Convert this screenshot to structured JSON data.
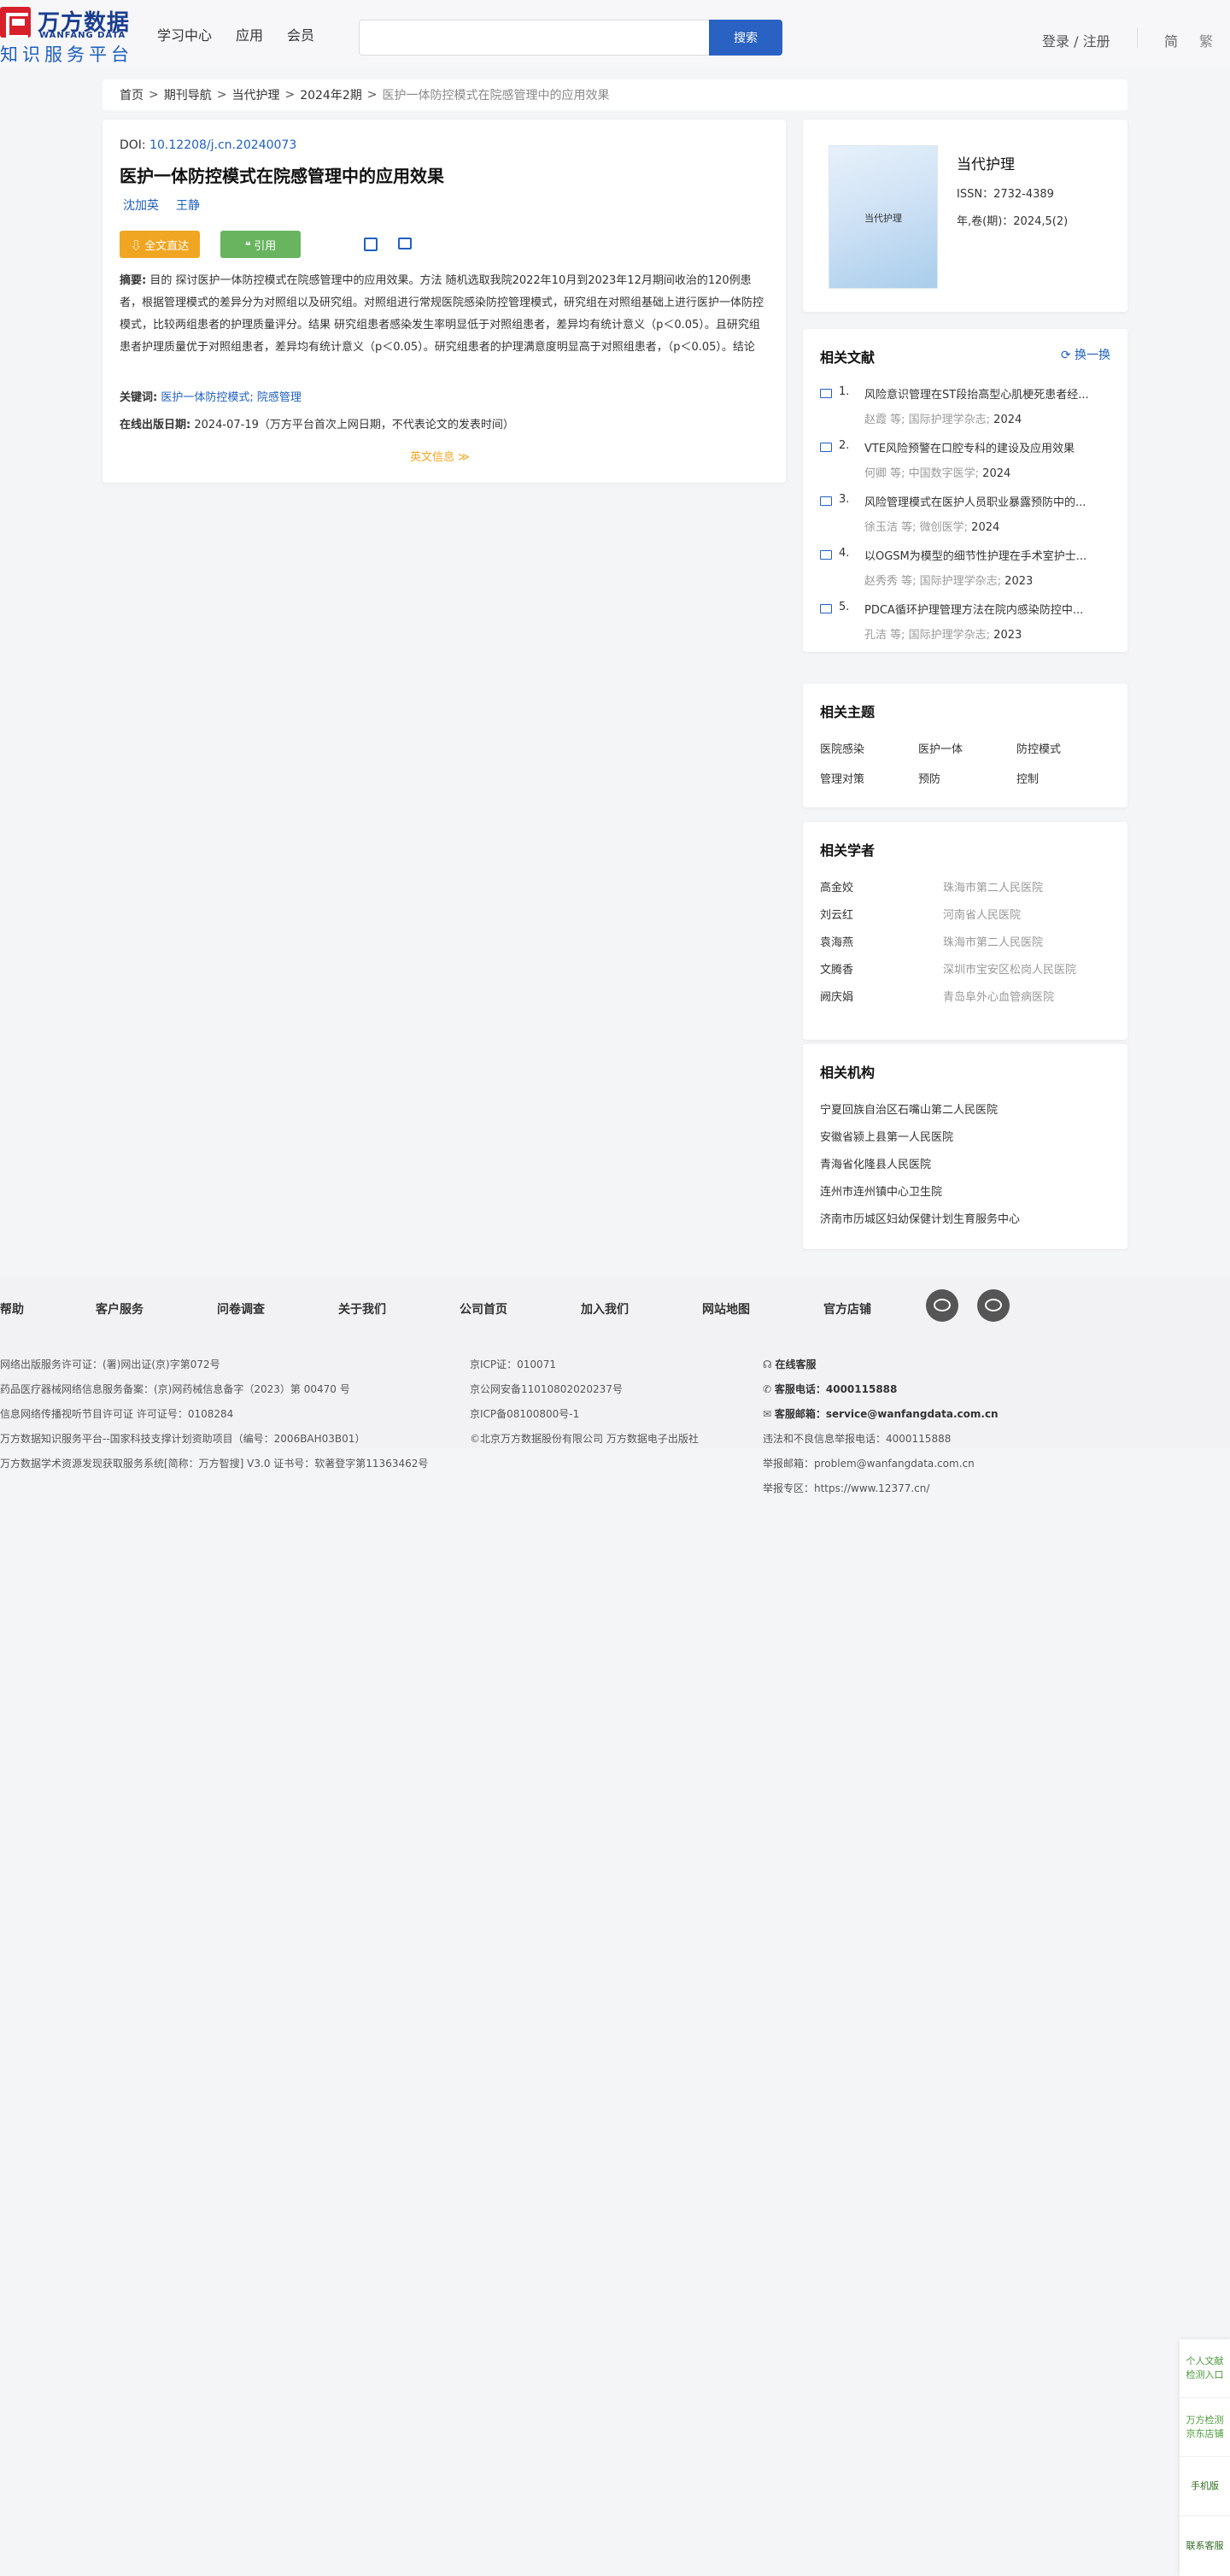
{
  "header": {
    "logo_cn": "万方数据",
    "logo_en": "WANFANG DATA",
    "logo_sub": "知识服务平台",
    "nav": [
      "学习中心",
      "应用",
      "会员"
    ],
    "search_button": "搜索",
    "search_placeholder": "",
    "login": "登录 / 注册",
    "lang_simp": "简",
    "lang_trad": "繁"
  },
  "breadcrumb": {
    "items": [
      "首页",
      "期刊导航",
      "当代护理",
      "2024年2期"
    ],
    "current": "医护一体防控模式在院感管理中的应用效果"
  },
  "article": {
    "doi_label": "DOI: ",
    "doi_value": "10.12208/j.cn.20240073",
    "title": "医护一体防控模式在院感管理中的应用效果",
    "authors": [
      "沈加英",
      "王静"
    ],
    "btn_full": "⇩ 全文直达",
    "btn_cite": "❝ 引用",
    "abstract_label": "摘要:",
    "abstract_text": " 目的 探讨医护一体防控模式在院感管理中的应用效果。方法 随机选取我院2022年10月到2023年12月期间收治的120例患者，根据管理模式的差异分为对照组以及研究组。对照组进行常规医院感染防控管理模式，研究组在对照组基础上进行医护一体防控模式，比较两组患者的护理质量评分。结果 研究组患者感染发生率明显低于对照组患者，差异均有统计意义（p＜0.05）。且研究组患者护理质量优于对照组患者，差异均有统计意义（p＜0.05）。研究组患者的护理满意度明显高于对照组患者，（p＜0.05）。结论 对患者采用医护一体防控模式效果显著，不但能保障患者的生命安全，降低感染...",
    "keywords_label": "关键词:",
    "keywords": "医护一体防控模式; 院感管理",
    "pubdate_label": "在线出版日期:",
    "pubdate": "2024-07-19（万方平台首次上网日期，不代表论文的发表时间）",
    "en_info": "英文信息 ≫"
  },
  "journal": {
    "cover_title": "当代护理",
    "name": "当代护理",
    "issn": "ISSN：2732-4389",
    "vol": "年,卷(期)：2024,5(2)"
  },
  "related": {
    "title": "相关文献",
    "refresh": "换一换",
    "items": [
      {
        "num": "1.",
        "title": "风险意识管理在ST段抬高型心肌梗死患者经...",
        "meta": "赵霞 等;  国际护理学杂志",
        "year": "2024"
      },
      {
        "num": "2.",
        "title": "VTE风险预警在口腔专科的建设及应用效果",
        "meta": "何卿 等;  中国数字医学",
        "year": "2024"
      },
      {
        "num": "3.",
        "title": "风险管理模式在医护人员职业暴露预防中的...",
        "meta": "徐玉洁 等;  微创医学",
        "year": "2024"
      },
      {
        "num": "4.",
        "title": "以OGSM为模型的细节性护理在手术室护士...",
        "meta": "赵秀秀 等;  国际护理学杂志",
        "year": "2023"
      },
      {
        "num": "5.",
        "title": "PDCA循环护理管理方法在院内感染防控中...",
        "meta": "孔洁 等;  国际护理学杂志",
        "year": "2023"
      }
    ]
  },
  "topics": {
    "title": "相关主题",
    "items": [
      "医院感染",
      "医护一体",
      "防控模式",
      "管理对策",
      "预防",
      "控制"
    ]
  },
  "scholars": {
    "title": "相关学者",
    "items": [
      {
        "name": "高金姣",
        "org": "珠海市第二人民医院"
      },
      {
        "name": "刘云红",
        "org": "河南省人民医院"
      },
      {
        "name": "袁海燕",
        "org": "珠海市第二人民医院"
      },
      {
        "name": "文腾香",
        "org": "深圳市宝安区松岗人民医院"
      },
      {
        "name": "阙庆娟",
        "org": "青岛阜外心血管病医院"
      }
    ]
  },
  "orgs": {
    "title": "相关机构",
    "items": [
      "宁夏回族自治区石嘴山第二人民医院",
      "安徽省颍上县第一人民医院",
      "青海省化隆县人民医院",
      "连州市连州镇中心卫生院",
      "济南市历城区妇幼保健计划生育服务中心"
    ]
  },
  "footer": {
    "links": [
      "帮助",
      "客户服务",
      "问卷调查",
      "关于我们",
      "公司首页",
      "加入我们",
      "网站地图",
      "官方店铺"
    ],
    "col1": [
      "网络出版服务许可证：(署)网出证(京)字第072号",
      "药品医疗器械网络信息服务备案：(京)网药械信息备字（2023）第 00470 号",
      "信息网络传播视听节目许可证 许可证号：0108284",
      "万方数据知识服务平台--国家科技支撑计划资助项目（编号：2006BAH03B01）",
      "万方数据学术资源发现获取服务系统[简称：万方智搜] V3.0 证书号：软著登字第11363462号"
    ],
    "col2": [
      "京ICP证：010071",
      "京公网安备11010802020237号",
      "京ICP备08100800号-1",
      "©北京万方数据股份有限公司 万方数据电子出版社"
    ],
    "col3": [
      "在线客服",
      "客服电话：4000115888",
      "客服邮箱：service@wanfangdata.com.cn",
      "违法和不良信息举报电话：4000115888",
      "举报邮箱：problem@wanfangdata.com.cn",
      "举报专区：https://www.12377.cn/"
    ]
  },
  "float": [
    "个人文献检测入口",
    "万方检测京东店铺",
    "手机版",
    "联系客服"
  ]
}
